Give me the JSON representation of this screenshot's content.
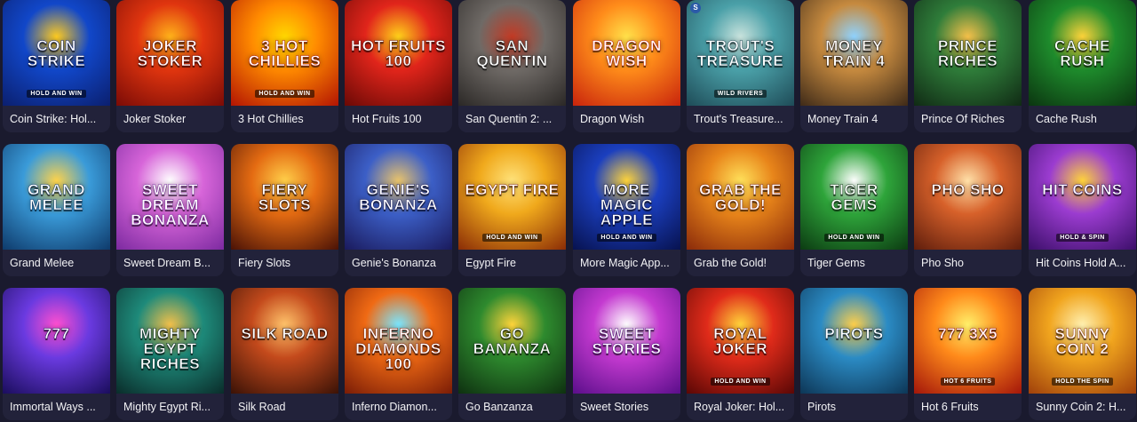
{
  "games": [
    {
      "title": "Coin Strike: Hol...",
      "art": "COIN STRIKE",
      "sub": "HOLD AND WIN",
      "colors": [
        "#1147c9",
        "#0b1f6e",
        "#ffcb1f"
      ],
      "badge": ""
    },
    {
      "title": "Joker Stoker",
      "art": "JOKER STOKER",
      "sub": "",
      "colors": [
        "#e0350f",
        "#7a0b06",
        "#ffb21a"
      ],
      "badge": ""
    },
    {
      "title": "3 Hot Chillies",
      "art": "3 HOT CHILLIES",
      "sub": "HOLD AND WIN",
      "colors": [
        "#ff8a00",
        "#b21403",
        "#ffd700"
      ],
      "badge": ""
    },
    {
      "title": "Hot Fruits 100",
      "art": "HOT FRUITS 100",
      "sub": "",
      "colors": [
        "#e1251b",
        "#6a0905",
        "#ffd21a"
      ],
      "badge": ""
    },
    {
      "title": "San Quentin 2: ...",
      "art": "SAN QUENTIN",
      "sub": "",
      "colors": [
        "#6f6a66",
        "#2b2826",
        "#c33a24"
      ],
      "badge": ""
    },
    {
      "title": "Dragon Wish",
      "art": "DRAGON WISH",
      "sub": "",
      "colors": [
        "#ff8c1a",
        "#c8230c",
        "#ffe14a"
      ],
      "badge": ""
    },
    {
      "title": "Trout's Treasure...",
      "art": "TROUT'S TREASURE",
      "sub": "WILD RIVERS",
      "colors": [
        "#4aa0a8",
        "#1e4b57",
        "#c9e3dd"
      ],
      "badge": "S"
    },
    {
      "title": "Money Train 4",
      "art": "MONEY TRAIN 4",
      "sub": "",
      "colors": [
        "#c68a3f",
        "#3e2a18",
        "#8fd3ff"
      ],
      "badge": ""
    },
    {
      "title": "Prince Of Riches",
      "art": "PRINCE RICHES",
      "sub": "",
      "colors": [
        "#2f7d3a",
        "#102a14",
        "#f6c14a"
      ],
      "badge": ""
    },
    {
      "title": "Cache Rush",
      "art": "CACHE RUSH",
      "sub": "",
      "colors": [
        "#1e8b2c",
        "#0b3510",
        "#ffd43a"
      ],
      "badge": ""
    },
    {
      "title": "Grand Melee",
      "art": "GRAND MELEE",
      "sub": "",
      "colors": [
        "#3a9bd9",
        "#0e3a6b",
        "#ffd34a"
      ],
      "badge": ""
    },
    {
      "title": "Sweet Dream B...",
      "art": "SWEET DREAM BONANZA",
      "sub": "",
      "colors": [
        "#d765d9",
        "#7c2aa0",
        "#ffffff"
      ],
      "badge": ""
    },
    {
      "title": "Fiery Slots",
      "art": "FIERY SLOTS",
      "sub": "",
      "colors": [
        "#e46b12",
        "#4a1206",
        "#ffcf4a"
      ],
      "badge": ""
    },
    {
      "title": "Genie's Bonanza",
      "art": "GENIE'S BONANZA",
      "sub": "",
      "colors": [
        "#3c5fc7",
        "#1a1a5c",
        "#e9c36b"
      ],
      "badge": ""
    },
    {
      "title": "Egypt Fire",
      "art": "EGYPT FIRE",
      "sub": "HOLD AND WIN",
      "colors": [
        "#f0a91c",
        "#8a2c06",
        "#ffe27a"
      ],
      "badge": ""
    },
    {
      "title": "More Magic App...",
      "art": "MORE MAGIC APPLE",
      "sub": "HOLD AND WIN",
      "colors": [
        "#1b3fbf",
        "#07124f",
        "#ffd43a"
      ],
      "badge": ""
    },
    {
      "title": "Grab the Gold!",
      "art": "GRAB THE GOLD!",
      "sub": "",
      "colors": [
        "#e8851a",
        "#8a2a0a",
        "#ffe05a"
      ],
      "badge": ""
    },
    {
      "title": "Tiger Gems",
      "art": "TIGER GEMS",
      "sub": "HOLD AND WIN",
      "colors": [
        "#2ea43a",
        "#0c3b12",
        "#ffffff"
      ],
      "badge": ""
    },
    {
      "title": "Pho Sho",
      "art": "PHO SHO",
      "sub": "",
      "colors": [
        "#d7612a",
        "#5e1d0c",
        "#ffe0a8"
      ],
      "badge": ""
    },
    {
      "title": "Hit Coins Hold A...",
      "art": "HIT COINS",
      "sub": "HOLD & SPIN",
      "colors": [
        "#9b3cd0",
        "#3c0f6a",
        "#ffd43a"
      ],
      "badge": ""
    },
    {
      "title": "Immortal Ways ...",
      "art": "777",
      "sub": "",
      "colors": [
        "#6a3ae0",
        "#1a0d5c",
        "#ff4fd0"
      ],
      "badge": ""
    },
    {
      "title": "Mighty Egypt Ri...",
      "art": "MIGHTY EGYPT RICHES",
      "sub": "",
      "colors": [
        "#1e8a7a",
        "#0a2c2a",
        "#f3c04a"
      ],
      "badge": ""
    },
    {
      "title": "Silk Road",
      "art": "SILK ROAD",
      "sub": "",
      "colors": [
        "#c44a1c",
        "#3a1206",
        "#ffc36b"
      ],
      "badge": ""
    },
    {
      "title": "Inferno Diamon...",
      "art": "INFERNO DIAMONDS 100",
      "sub": "",
      "colors": [
        "#f06a14",
        "#7a1c06",
        "#7ae6ff"
      ],
      "badge": ""
    },
    {
      "title": "Go Banzanza",
      "art": "GO BANANZA",
      "sub": "",
      "colors": [
        "#2e8a2e",
        "#0e3010",
        "#ffd43a"
      ],
      "badge": ""
    },
    {
      "title": "Sweet Stories",
      "art": "SWEET STORIES",
      "sub": "",
      "colors": [
        "#c43ad0",
        "#5a0e8a",
        "#ffffff"
      ],
      "badge": ""
    },
    {
      "title": "Royal Joker: Hol...",
      "art": "ROYAL JOKER",
      "sub": "HOLD AND WIN",
      "colors": [
        "#e02b1a",
        "#5a0705",
        "#ffd43a"
      ],
      "badge": ""
    },
    {
      "title": "Pirots",
      "art": "PIROTS",
      "sub": "",
      "colors": [
        "#2b8bc4",
        "#0d3656",
        "#ffcf4a"
      ],
      "badge": ""
    },
    {
      "title": "Hot 6 Fruits",
      "art": "777 3x5",
      "sub": "HOT 6 FRUITS",
      "colors": [
        "#ff8a1a",
        "#a3160a",
        "#fff06a"
      ],
      "badge": ""
    },
    {
      "title": "Sunny Coin 2: H...",
      "art": "SUNNY COIN 2",
      "sub": "HOLD THE SPIN",
      "colors": [
        "#f1a51e",
        "#a0400a",
        "#fff0b0"
      ],
      "badge": ""
    }
  ]
}
